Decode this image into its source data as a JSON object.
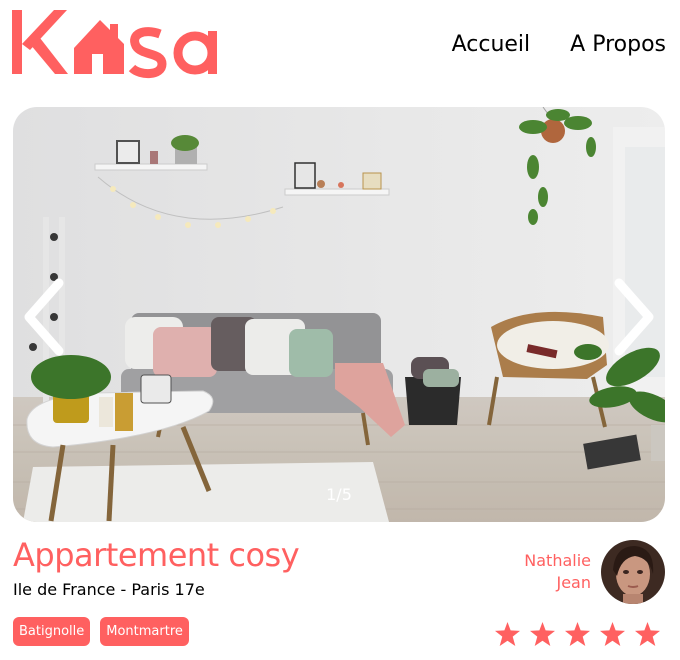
{
  "brand": {
    "name": "Kasa",
    "color": "#FF6060",
    "logo_icon": "house-icon"
  },
  "nav": {
    "items": [
      {
        "label": "Accueil"
      },
      {
        "label": "A Propos"
      }
    ]
  },
  "carousel": {
    "counter": "1/5",
    "prev_icon": "chevron-left-icon",
    "next_icon": "chevron-right-icon"
  },
  "listing": {
    "title": "Appartement cosy",
    "location": "Ile de France - Paris 17e",
    "tags": [
      "Batignolle",
      "Montmartre"
    ],
    "rating": 5,
    "rating_max": 5
  },
  "host": {
    "first_name": "Nathalie",
    "last_name": "Jean"
  },
  "colors": {
    "accent": "#FF6060",
    "text": "#000000"
  }
}
